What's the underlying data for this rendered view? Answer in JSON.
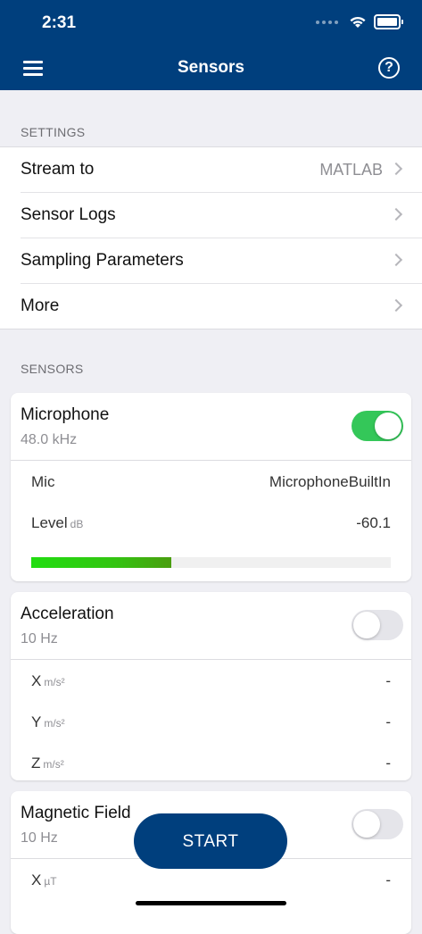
{
  "status_bar": {
    "time": "2:31",
    "wifi_icon": "wifi-icon",
    "battery_icon": "battery-icon"
  },
  "nav": {
    "title": "Sensors",
    "menu_icon": "hamburger-menu-icon",
    "help_icon": "question-mark-icon",
    "help_glyph": "?"
  },
  "colors": {
    "nav_bg": "#003f7d",
    "toggle_on": "#34c759",
    "meter_green": "#22dd11"
  },
  "settings": {
    "header": "SETTINGS",
    "items": [
      {
        "label": "Stream to",
        "value": "MATLAB"
      },
      {
        "label": "Sensor Logs",
        "value": ""
      },
      {
        "label": "Sampling Parameters",
        "value": ""
      },
      {
        "label": "More",
        "value": ""
      }
    ]
  },
  "sensors": {
    "header": "SENSORS",
    "microphone": {
      "title": "Microphone",
      "rate": "48.0 kHz",
      "enabled": true,
      "mic_label": "Mic",
      "mic_value": "MicrophoneBuiltIn",
      "level_label": "Level",
      "level_unit": "dB",
      "level_value": "-60.1",
      "level_fraction": 0.39
    },
    "acceleration": {
      "title": "Acceleration",
      "rate": "10 Hz",
      "enabled": false,
      "axes": [
        {
          "label": "X",
          "unit": "m/s²",
          "value": "-"
        },
        {
          "label": "Y",
          "unit": "m/s²",
          "value": "-"
        },
        {
          "label": "Z",
          "unit": "m/s²",
          "value": "-"
        }
      ]
    },
    "magnetic_field": {
      "title": "Magnetic Field",
      "rate": "10 Hz",
      "enabled": false,
      "axes": [
        {
          "label": "X",
          "unit": "µT",
          "value": "-"
        }
      ]
    }
  },
  "start_button": {
    "label": "START"
  }
}
